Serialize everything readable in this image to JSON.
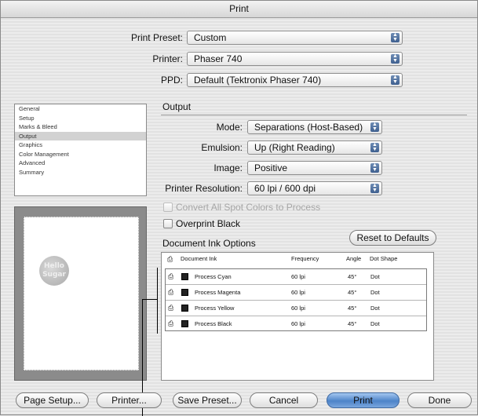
{
  "window": {
    "title": "Print"
  },
  "top_fields": {
    "print_preset": {
      "label": "Print Preset:",
      "value": "Custom"
    },
    "printer": {
      "label": "Printer:",
      "value": "Phaser 740"
    },
    "ppd": {
      "label": "PPD:",
      "value": "Default (Tektronix Phaser 740)"
    }
  },
  "categories": [
    {
      "label": "General",
      "selected": false
    },
    {
      "label": "Setup",
      "selected": false
    },
    {
      "label": "Marks & Bleed",
      "selected": false
    },
    {
      "label": "Output",
      "selected": true
    },
    {
      "label": "Graphics",
      "selected": false
    },
    {
      "label": "Color Management",
      "selected": false
    },
    {
      "label": "Advanced",
      "selected": false
    },
    {
      "label": "Summary",
      "selected": false
    }
  ],
  "output": {
    "section_title": "Output",
    "mode": {
      "label": "Mode:",
      "value": "Separations (Host-Based)"
    },
    "emulsion": {
      "label": "Emulsion:",
      "value": "Up (Right Reading)"
    },
    "image": {
      "label": "Image:",
      "value": "Positive"
    },
    "resolution": {
      "label": "Printer Resolution:",
      "value": "60 lpi / 600 dpi"
    },
    "convert_spot": {
      "label": "Convert All Spot Colors to Process",
      "checked": false,
      "enabled": false
    },
    "overprint_black": {
      "label": "Overprint Black",
      "checked": false,
      "enabled": true
    }
  },
  "preview": {
    "logo_text_1": "Hello",
    "logo_text_2": "Sugar"
  },
  "ink_options": {
    "title": "Document Ink Options",
    "reset_label": "Reset to Defaults",
    "columns": [
      "Document Ink",
      "Frequency",
      "Angle",
      "Dot Shape"
    ],
    "rows": [
      {
        "ink": "Process Cyan",
        "frequency": "60 lpi",
        "angle": "45°",
        "dot": "Dot"
      },
      {
        "ink": "Process Magenta",
        "frequency": "60 lpi",
        "angle": "45°",
        "dot": "Dot"
      },
      {
        "ink": "Process Yellow",
        "frequency": "60 lpi",
        "angle": "45°",
        "dot": "Dot"
      },
      {
        "ink": "Process Black",
        "frequency": "60 lpi",
        "angle": "45°",
        "dot": "Dot"
      }
    ]
  },
  "buttons": {
    "page_setup": "Page Setup...",
    "printer": "Printer...",
    "save_preset": "Save Preset...",
    "cancel": "Cancel",
    "print": "Print",
    "done": "Done"
  },
  "icons": {
    "popup_arrows": "up-down-arrows-icon",
    "ink_print_toggle": "printer-icon",
    "ink_swatch": "color-swatch-icon"
  },
  "colors": {
    "default_button": "#4d83c8",
    "popup_arrow": "#3e5f8f"
  }
}
